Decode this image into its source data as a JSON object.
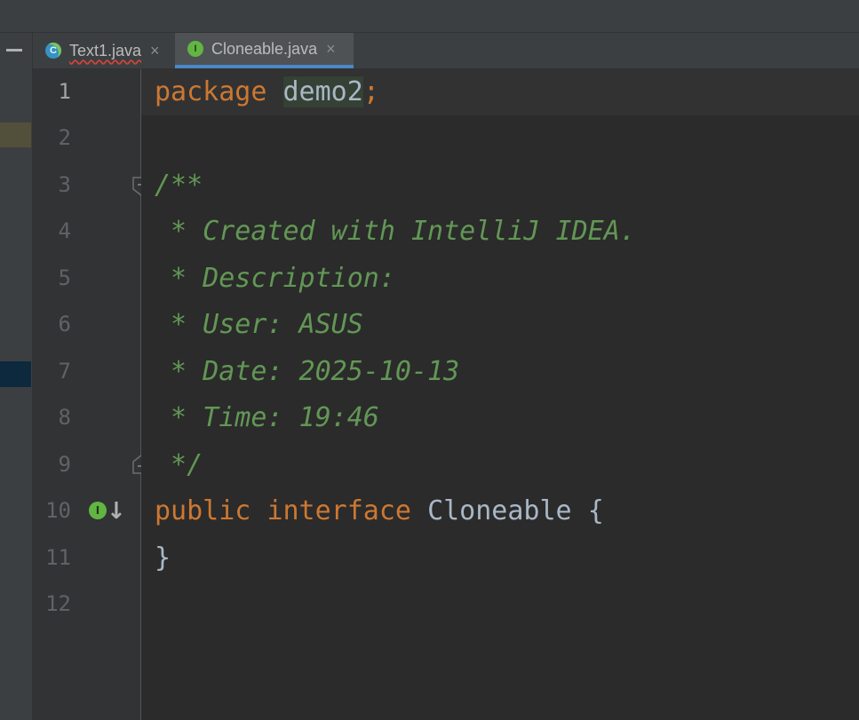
{
  "tabs": [
    {
      "label": "Text1.java",
      "icon": "class-icon",
      "active": false,
      "close": "×"
    },
    {
      "label": "Cloneable.java",
      "icon": "interface-icon",
      "active": true,
      "close": "×"
    }
  ],
  "icons": {
    "class_letter": "C",
    "interface_letter": "I",
    "implemented_arrow": "↓"
  },
  "line_numbers": [
    "1",
    "2",
    "3",
    "4",
    "5",
    "6",
    "7",
    "8",
    "9",
    "10",
    "11",
    "12"
  ],
  "code": {
    "line1_keyword": "package",
    "line1_space": " ",
    "line1_package": "demo2",
    "line1_semicolon": ";",
    "line3": "/**",
    "line4": " * Created with IntelliJ IDEA.",
    "line5": " * Description:",
    "line6": " * User: ASUS",
    "line7": " * Date: 2025-10-13",
    "line8": " * Time: 19:46",
    "line9": " */",
    "line10_kw1": "public",
    "line10_kw2": "interface",
    "line10_name": "Cloneable",
    "line10_brace": "{",
    "line11": "}"
  },
  "colors": {
    "keyword": "#cc7832",
    "doc_comment": "#629755",
    "identifier": "#a9b7c6",
    "editor_bg": "#2b2b2b",
    "active_tab_underline": "#4a88c7"
  }
}
